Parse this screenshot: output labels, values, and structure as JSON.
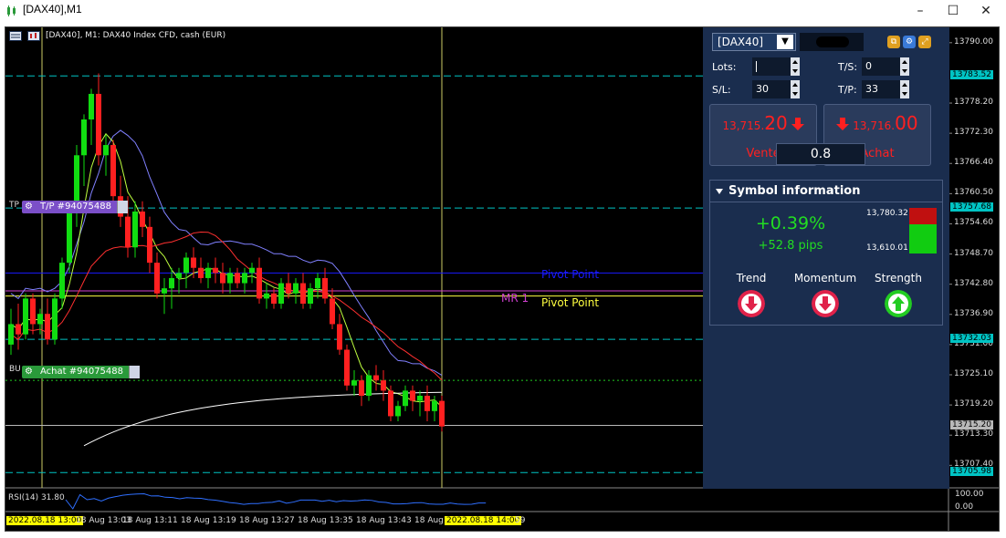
{
  "window": {
    "title": "[DAX40],M1",
    "icon": "chart-candles-icon",
    "buttons": [
      "minimize",
      "maximize",
      "close"
    ]
  },
  "chart_header": {
    "text": "[DAX40], M1:  DAX40 Index CFD, cash (EUR)"
  },
  "y_axis": {
    "ticks": [
      "13790.00",
      "13778.20",
      "13772.30",
      "13766.40",
      "13760.50",
      "13754.60",
      "13748.70",
      "13742.80",
      "13736.90",
      "13731.00",
      "13725.10",
      "13719.20",
      "13713.30",
      "13707.40"
    ],
    "highlights": [
      {
        "label": "13783.52",
        "color": "#00c4c4"
      },
      {
        "label": "13757.68",
        "color": "#00c4c4"
      },
      {
        "label": "13732.03",
        "color": "#00c4c4"
      },
      {
        "label": "13715.20",
        "color": "#b8b8b8"
      },
      {
        "label": "13705.98",
        "color": "#00c4c4"
      }
    ]
  },
  "x_axis": {
    "labels": [
      "2022.08.18 13:00",
      "18 Aug 13:03",
      "18 Aug 13:11",
      "18 Aug 13:19",
      "18 Aug 13:27",
      "18 Aug 13:35",
      "18 Aug 13:43",
      "18 Aug",
      "2022.08.18 14:00",
      "59"
    ]
  },
  "order_tags": {
    "tp": {
      "prefix": "TP",
      "label": "T/P #94075488",
      "color": "#7b4fc8"
    },
    "buy": {
      "prefix": "BU",
      "label": "Achat #94075488",
      "color": "#2a9a3a"
    }
  },
  "pivots": {
    "pivot_blue": "Pivot Point",
    "mr": "MR 1",
    "pivot_yellow": "Pivot Point"
  },
  "chart_data": {
    "type": "candlestick",
    "symbol": "DAX40",
    "timeframe": "M1",
    "ylim": [
      13703.0,
      13793.0
    ],
    "x_range": [
      "13:00",
      "14:00"
    ],
    "candles": [
      [
        13731,
        13738,
        13729,
        13735
      ],
      [
        13735,
        13739,
        13730,
        13733
      ],
      [
        13733,
        13741,
        13732,
        13740
      ],
      [
        13740,
        13741,
        13733,
        13735
      ],
      [
        13735,
        13738,
        13733,
        13737
      ],
      [
        13737,
        13740,
        13731,
        13732
      ],
      [
        13732,
        13741,
        13731,
        13740
      ],
      [
        13740,
        13748,
        13738,
        13747
      ],
      [
        13747,
        13759,
        13745,
        13758
      ],
      [
        13758,
        13770,
        13754,
        13768
      ],
      [
        13768,
        13776,
        13762,
        13775
      ],
      [
        13775,
        13781,
        13770,
        13780
      ],
      [
        13780,
        13784,
        13766,
        13768
      ],
      [
        13768,
        13772,
        13764,
        13770
      ],
      [
        13770,
        13771,
        13758,
        13760
      ],
      [
        13760,
        13764,
        13754,
        13756
      ],
      [
        13756,
        13760,
        13748,
        13750
      ],
      [
        13750,
        13759,
        13748,
        13757
      ],
      [
        13757,
        13759,
        13752,
        13754
      ],
      [
        13754,
        13756,
        13745,
        13747
      ],
      [
        13747,
        13749,
        13740,
        13741
      ],
      [
        13741,
        13744,
        13737,
        13742
      ],
      [
        13742,
        13746,
        13738,
        13744
      ],
      [
        13744,
        13746,
        13741,
        13745
      ],
      [
        13745,
        13749,
        13742,
        13748
      ],
      [
        13748,
        13750,
        13744,
        13746
      ],
      [
        13746,
        13748,
        13743,
        13744
      ],
      [
        13744,
        13747,
        13742,
        13746
      ],
      [
        13746,
        13748,
        13743,
        13745
      ],
      [
        13745,
        13747,
        13741,
        13743
      ],
      [
        13743,
        13746,
        13741,
        13745
      ],
      [
        13745,
        13746,
        13742,
        13743
      ],
      [
        13743,
        13746,
        13741,
        13745
      ],
      [
        13745,
        13747,
        13743,
        13746
      ],
      [
        13746,
        13748,
        13739,
        13740
      ],
      [
        13740,
        13743,
        13738,
        13741
      ],
      [
        13741,
        13742,
        13738,
        13739
      ],
      [
        13739,
        13744,
        13738,
        13743
      ],
      [
        13743,
        13745,
        13740,
        13741
      ],
      [
        13741,
        13744,
        13739,
        13743
      ],
      [
        13743,
        13745,
        13738,
        13739
      ],
      [
        13739,
        13743,
        13738,
        13742
      ],
      [
        13742,
        13745,
        13740,
        13744
      ],
      [
        13744,
        13746,
        13739,
        13740
      ],
      [
        13740,
        13742,
        13734,
        13735
      ],
      [
        13735,
        13737,
        13729,
        13730
      ],
      [
        13730,
        13731,
        13722,
        13723
      ],
      [
        13723,
        13726,
        13721,
        13724
      ],
      [
        13724,
        13725,
        13719,
        13721
      ],
      [
        13721,
        13726,
        13720,
        13725
      ],
      [
        13725,
        13727,
        13722,
        13724
      ],
      [
        13724,
        13726,
        13720,
        13722
      ],
      [
        13722,
        13723,
        13716,
        13717
      ],
      [
        13717,
        13720,
        13716,
        13719
      ],
      [
        13719,
        13723,
        13718,
        13722
      ],
      [
        13722,
        13723,
        13718,
        13720
      ],
      [
        13720,
        13722,
        13717,
        13721
      ],
      [
        13721,
        13723,
        13716,
        13718
      ],
      [
        13718,
        13721,
        13716,
        13720
      ],
      [
        13720,
        13721,
        13714,
        13715
      ]
    ],
    "horizontal_lines": [
      {
        "label": "13783.52",
        "value": 13783.52,
        "style": "dashed",
        "color": "#00c4c4"
      },
      {
        "label": "T/P",
        "value": 13757.68,
        "style": "dashed",
        "color": "#00c4c4"
      },
      {
        "label": "Pivot Point",
        "value": 13745.0,
        "style": "solid",
        "color": "#1a1aff"
      },
      {
        "label": "MR 1",
        "value": 13741.5,
        "style": "solid",
        "color": "#d040d0"
      },
      {
        "label": "Pivot Point",
        "value": 13740.5,
        "style": "solid",
        "color": "#ffff40"
      },
      {
        "label": "13732.03",
        "value": 13732.03,
        "style": "dashed",
        "color": "#00c4c4"
      },
      {
        "label": "Achat",
        "value": 13724.0,
        "style": "dotted",
        "color": "#22cc22"
      },
      {
        "label": "13715.20",
        "value": 13715.2,
        "style": "solid",
        "color": "#b8b8b8"
      },
      {
        "label": "13705.98",
        "value": 13705.98,
        "style": "dashed",
        "color": "#00c4c4"
      }
    ],
    "rsi": {
      "label": "RSI(14) 31.80",
      "value": 31.8,
      "ticks": [
        "100.00",
        "0.00"
      ]
    }
  },
  "trade_panel": {
    "symbol": "[DAX40]",
    "lots_label": "Lots:",
    "lots_value": "",
    "ts_label": "T/S:",
    "ts_value": "0",
    "sl_label": "S/L:",
    "sl_value": "30",
    "tp_label": "T/P:",
    "tp_value": "33",
    "sell_price_small": "13,715.",
    "sell_price_big": "20",
    "sell_label": "Vente",
    "buy_price_small": "13,716.",
    "buy_price_big": "00",
    "buy_label": "Achat",
    "volume": "0.8",
    "icons": [
      "copy-icon",
      "settings-icon",
      "expand-icon"
    ]
  },
  "symbol_info": {
    "title": "Symbol information",
    "change_pct": "+0.39%",
    "change_pips": "+52.8 pips",
    "high": "13,780.32",
    "low": "13,610.01",
    "trend_label": "Trend",
    "momentum_label": "Momentum",
    "strength_label": "Strength",
    "trend": "down",
    "momentum": "down",
    "strength": "up",
    "colors": {
      "down": "#e0224a",
      "up": "#22cc22"
    }
  }
}
